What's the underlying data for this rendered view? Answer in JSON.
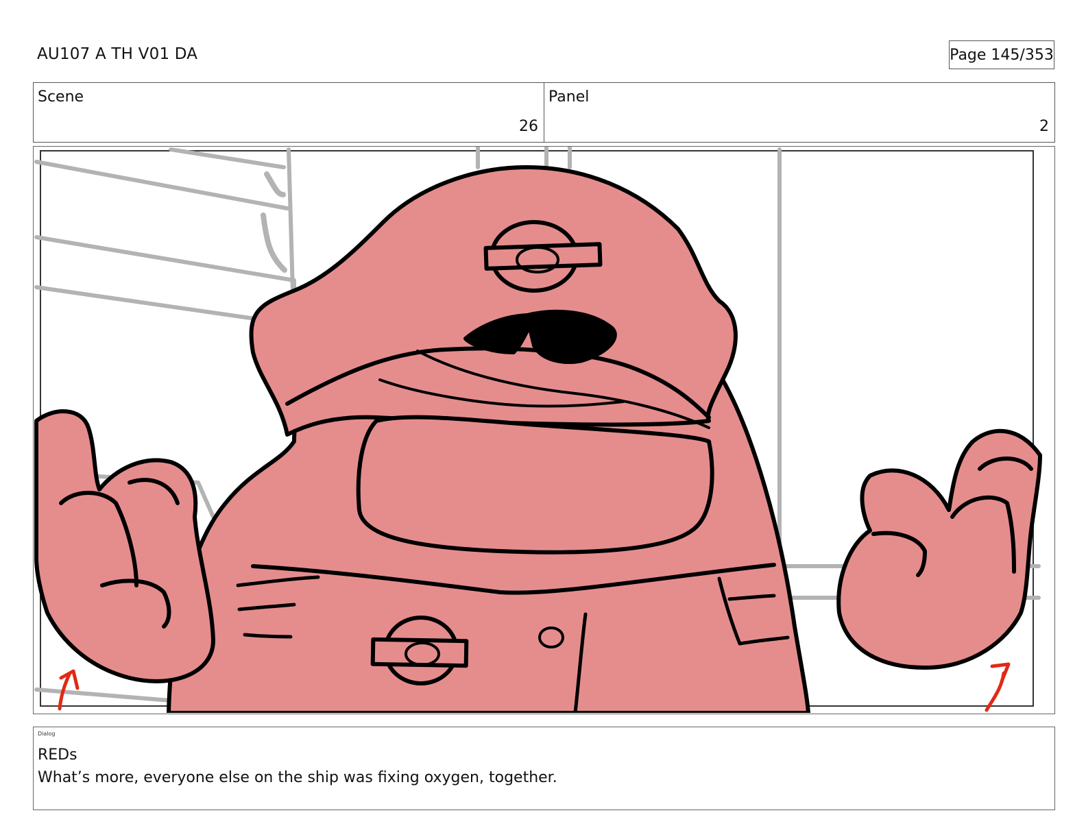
{
  "header": {
    "doc_title": "AU107 A TH V01 DA",
    "page_label": "Page 145/353"
  },
  "meta": {
    "scene_label": "Scene",
    "scene_value": "26",
    "panel_label": "Panel",
    "panel_value": "2"
  },
  "panel_image": {
    "description_icon": "storyboard-drawing-icon",
    "colors": {
      "character_fill": "#e58d8d",
      "outline": "#000000",
      "background_lines": "#b3b3b3",
      "arrows": "#e02a16"
    }
  },
  "dialog": {
    "tag": "Dialog",
    "speaker": "REDs",
    "line": "What’s more, everyone else on the ship was fixing oxygen, together."
  }
}
